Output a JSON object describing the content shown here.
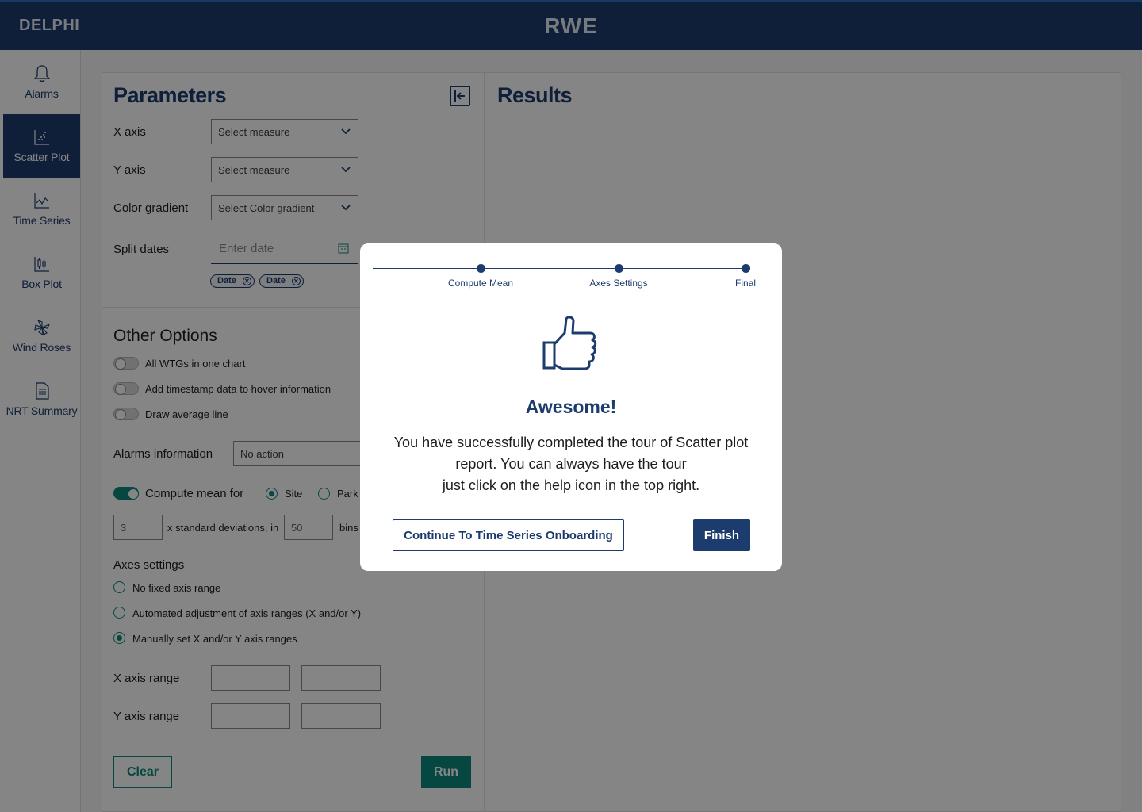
{
  "header": {
    "brand": "DELPHI",
    "logo": "RWE"
  },
  "sidebar": {
    "items": [
      {
        "label": "Alarms",
        "icon": "bell-icon"
      },
      {
        "label": "Scatter Plot",
        "icon": "scatter-plot-icon",
        "active": true
      },
      {
        "label": "Time Series",
        "icon": "line-chart-icon"
      },
      {
        "label": "Box Plot",
        "icon": "box-plot-icon"
      },
      {
        "label": "Wind Roses",
        "icon": "wind-rose-icon"
      },
      {
        "label": "NRT Summary",
        "icon": "document-icon"
      }
    ]
  },
  "params": {
    "title": "Parameters",
    "x_axis": {
      "label": "X axis",
      "placeholder": "Select measure"
    },
    "y_axis": {
      "label": "Y axis",
      "placeholder": "Select measure"
    },
    "color_gradient": {
      "label": "Color gradient",
      "placeholder": "Select Color gradient"
    },
    "split_dates": {
      "label": "Split dates",
      "placeholder": "Enter date",
      "chips": [
        "Date",
        "Date"
      ]
    }
  },
  "other_options": {
    "title": "Other Options",
    "toggles": [
      {
        "label": "All WTGs in one chart",
        "on": false
      },
      {
        "label": "Add timestamp data to hover information",
        "on": false
      },
      {
        "label": "Draw average line",
        "on": false
      }
    ],
    "alarms_information": {
      "label": "Alarms information",
      "value": "No action"
    },
    "compute_mean": {
      "label": "Compute mean for",
      "on": true,
      "options": [
        "Site",
        "Park"
      ],
      "selected": "Site"
    },
    "std_dev": {
      "value": "3",
      "text": "x standard deviations, in",
      "bins_value": "50",
      "bins_label": "bins"
    }
  },
  "axes_settings": {
    "title": "Axes settings",
    "options": [
      {
        "label": "No fixed axis range",
        "selected": false
      },
      {
        "label": "Automated adjustment of axis ranges (X and/or Y)",
        "selected": false
      },
      {
        "label": "Manually set X and/or Y axis ranges",
        "selected": true
      }
    ],
    "x_range_label": "X axis range",
    "y_range_label": "Y axis range"
  },
  "actions": {
    "clear": "Clear",
    "run": "Run"
  },
  "results": {
    "title": "Results"
  },
  "modal": {
    "steps": [
      "Compute Mean",
      "Axes Settings",
      "Final"
    ],
    "icon": "thumbs-up-icon",
    "title": "Awesome!",
    "body_lines": [
      "You have successfully completed the tour of Scatter plot",
      "report. You can always have the tour",
      "just click on the help icon in the top right."
    ],
    "continue_label": "Continue To Time Series Onboarding",
    "finish_label": "Finish"
  },
  "colors": {
    "primary": "#1d3c6e",
    "accent": "#0d8a7e"
  }
}
